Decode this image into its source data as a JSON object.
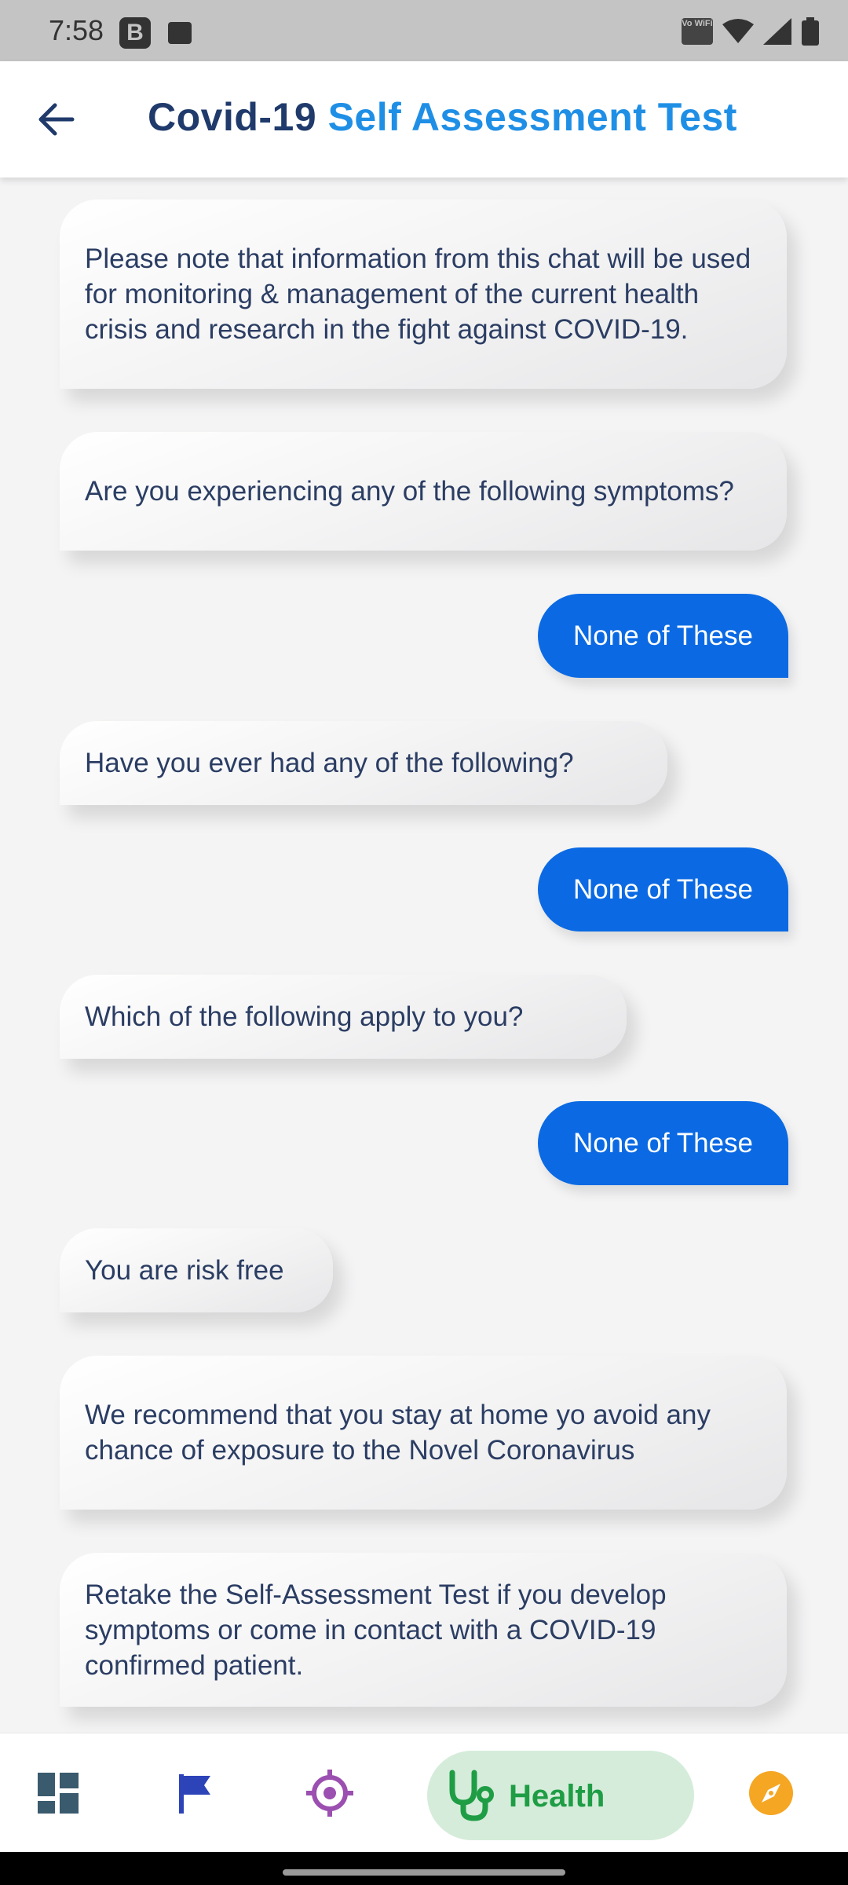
{
  "status_bar": {
    "time": "7:58",
    "b_badge": "B",
    "volte": "Vo WiFi"
  },
  "header": {
    "title_part1": "Covid-19",
    "title_part2": "Self Assessment Test",
    "title_colors": {
      "part1": "#1f3a6b",
      "part2": "#1f8fe6"
    }
  },
  "chat": {
    "messages": [
      {
        "from": "bot",
        "text": "Please note that information from this chat will be used for monitoring & management of the current health crisis and research in the fight against COVID-19."
      },
      {
        "from": "bot",
        "text": "Are you experiencing any of the following symptoms?"
      },
      {
        "from": "user",
        "text": "None of These"
      },
      {
        "from": "bot",
        "text": "Have you ever had any of the following?"
      },
      {
        "from": "user",
        "text": "None of These"
      },
      {
        "from": "bot",
        "text": "Which of the following apply to you?"
      },
      {
        "from": "user",
        "text": "None of These"
      },
      {
        "from": "bot",
        "text": "You are risk free"
      },
      {
        "from": "bot",
        "text": "We recommend that you stay at home yo avoid any chance of exposure to the Novel Coronavirus"
      },
      {
        "from": "bot",
        "text": "Retake the Self-Assessment Test if you develop symptoms or come in contact with a COVID-19 confirmed patient."
      }
    ],
    "user_bubble_color": "#0b6ae3"
  },
  "bottom_nav": {
    "items": [
      {
        "icon": "dashboard-icon"
      },
      {
        "icon": "flag-icon"
      },
      {
        "icon": "target-icon"
      },
      {
        "icon": "stethoscope-icon",
        "label": "Health",
        "active": true
      },
      {
        "icon": "compass-icon"
      }
    ]
  }
}
